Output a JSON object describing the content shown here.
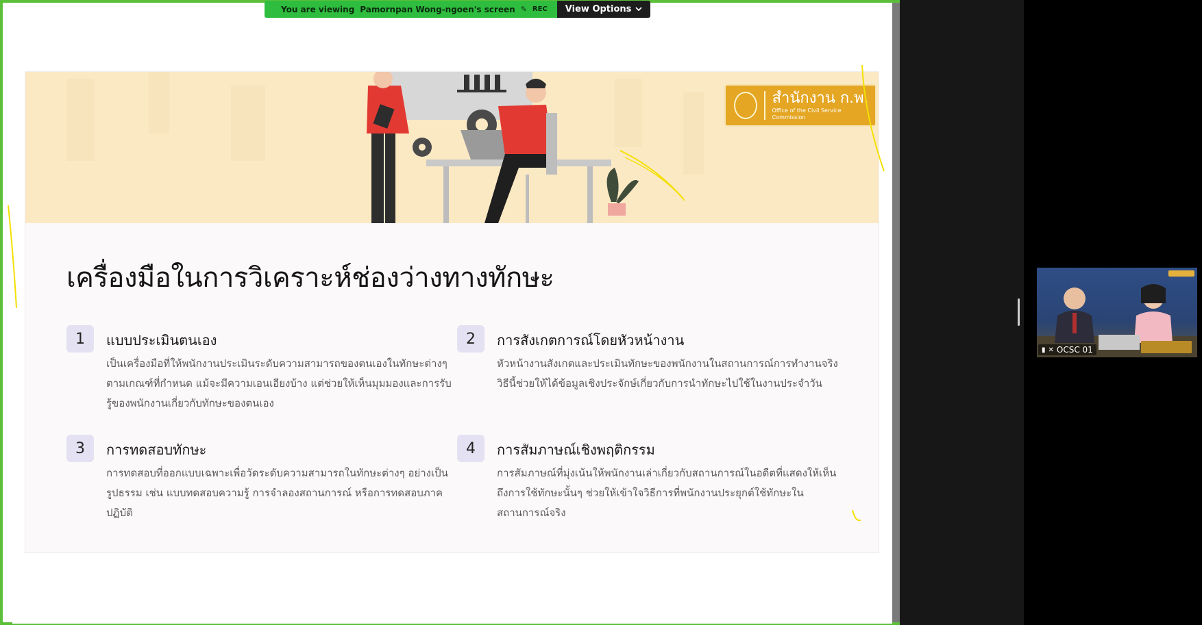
{
  "banner": {
    "viewing_prefix": "You are viewing",
    "viewing_name": "Pamornpan Wong-ngoen's screen",
    "rec_label": "REC",
    "view_options_label": "View Options"
  },
  "slide": {
    "logo_main": "สำนักงาน ก.พ.",
    "logo_sub": "Office of the Civil Service Commission",
    "title": "เครื่องมือในการวิเคราะห์ช่องว่างทางทักษะ",
    "tools": [
      {
        "number": "1",
        "title": "แบบประเมินตนเอง",
        "description": "เป็นเครื่องมือที่ให้พนักงานประเมินระดับความสามารถของตนเองในทักษะต่างๆ ตามเกณฑ์ที่กำหนด แม้จะมีความเอนเอียงบ้าง แต่ช่วยให้เห็นมุมมองและการรับรู้ของพนักงานเกี่ยวกับทักษะของตนเอง"
      },
      {
        "number": "2",
        "title": "การสังเกตการณ์โดยหัวหน้างาน",
        "description": "หัวหน้างานสังเกตและประเมินทักษะของพนักงานในสถานการณ์การทำงานจริง วิธีนี้ช่วยให้ได้ข้อมูลเชิงประจักษ์เกี่ยวกับการนำทักษะไปใช้ในงานประจำวัน"
      },
      {
        "number": "3",
        "title": "การทดสอบทักษะ",
        "description": "การทดสอบที่ออกแบบเฉพาะเพื่อวัดระดับความสามารถในทักษะต่างๆ อย่างเป็นรูปธรรม เช่น แบบทดสอบความรู้ การจำลองสถานการณ์ หรือการทดสอบภาคปฏิบัติ"
      },
      {
        "number": "4",
        "title": "การสัมภาษณ์เชิงพฤติกรรม",
        "description": "การสัมภาษณ์ที่มุ่งเน้นให้พนักงานเล่าเกี่ยวกับสถานการณ์ในอดีตที่แสดงให้เห็นถึงการใช้ทักษะนั้นๆ ช่วยให้เข้าใจวิธีการที่พนักงานประยุกต์ใช้ทักษะในสถานการณ์จริง"
      }
    ]
  },
  "participant": {
    "name": "OCSC 01"
  },
  "colors": {
    "share_border": "#5bbf3a",
    "banner_green": "#2ebd3f",
    "hero_bg": "#fbe9c4",
    "logo_gold": "#e4a623",
    "number_badge": "#e4e2f2"
  }
}
